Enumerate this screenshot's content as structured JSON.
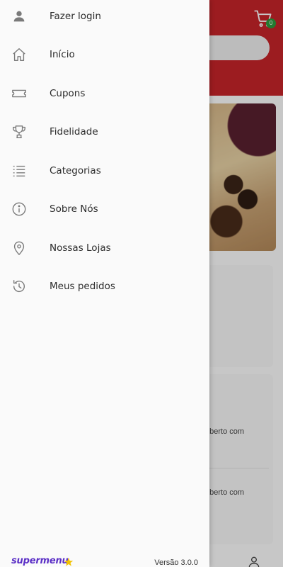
{
  "drawer": {
    "items": [
      {
        "label": "Fazer login",
        "icon": "person-icon"
      },
      {
        "label": "Início",
        "icon": "home-icon"
      },
      {
        "label": "Cupons",
        "icon": "ticket-icon"
      },
      {
        "label": "Fidelidade",
        "icon": "trophy-icon"
      },
      {
        "label": "Categorias",
        "icon": "list-icon"
      },
      {
        "label": "Sobre Nós",
        "icon": "info-icon"
      },
      {
        "label": "Nossas Lojas",
        "icon": "location-pin-icon"
      },
      {
        "label": "Meus pedidos",
        "icon": "history-icon"
      }
    ],
    "footer": {
      "brand": "supermenu",
      "version": "Versão 3.0.0"
    }
  },
  "background": {
    "cart_count": "0",
    "card_text_1": "oberto com",
    "card_text_2": "oberto com"
  },
  "colors": {
    "header_red": "#c8242a",
    "brand_purple": "#5b2fc6",
    "badge_green": "#2e9e3e"
  }
}
